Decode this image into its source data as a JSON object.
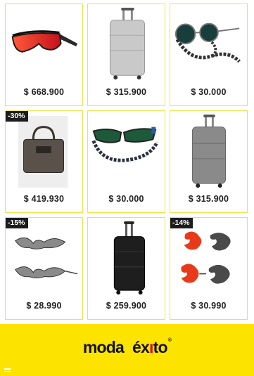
{
  "products": [
    {
      "icon": "sport-sunglasses-icon",
      "price": "$ 668.900",
      "badge": ""
    },
    {
      "icon": "suitcase-icon",
      "price": "$ 315.900",
      "badge": ""
    },
    {
      "icon": "round-sunglasses-strap-icon",
      "price": "$ 30.000",
      "badge": ""
    },
    {
      "icon": "handbag-icon",
      "price": "$ 419.930",
      "badge": "-30%"
    },
    {
      "icon": "sunglasses-strap-icon",
      "price": "$ 30.000",
      "badge": ""
    },
    {
      "icon": "suitcase-icon",
      "price": "$ 315.900",
      "badge": ""
    },
    {
      "icon": "flame-sunglasses-icon",
      "price": "$ 28.990",
      "badge": "-15%"
    },
    {
      "icon": "black-suitcase-icon",
      "price": "$ 259.900",
      "badge": ""
    },
    {
      "icon": "dragon-sunglasses-icon",
      "price": "$ 30.990",
      "badge": "-14%"
    }
  ],
  "footer": {
    "logo_word1": "moda",
    "logo_word2_pre": "éx",
    "logo_word2_dot": "ı",
    "logo_word2_post": "to",
    "logo_reg": "®",
    "menu_icon": "menu-icon",
    "background": "#fde400"
  },
  "colors": {
    "card_border": "#f2e04a",
    "badge_bg": "#1c1c1c",
    "accent_red": "#e2001a"
  }
}
